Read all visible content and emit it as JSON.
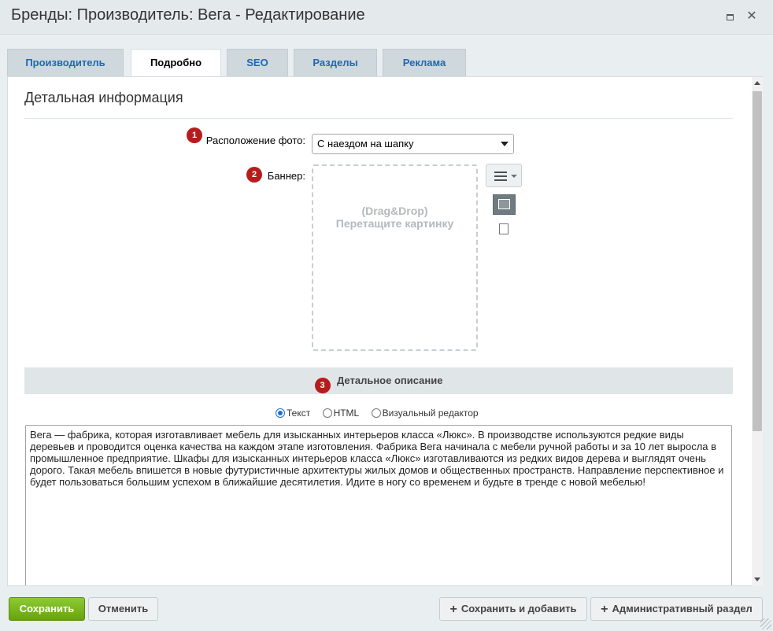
{
  "window": {
    "title": "Бренды: Производитель: Вега - Редактирование",
    "close_glyph": "✕"
  },
  "tabs": [
    {
      "label": "Производитель",
      "active": false
    },
    {
      "label": "Подробно",
      "active": true
    },
    {
      "label": "SEO",
      "active": false
    },
    {
      "label": "Разделы",
      "active": false
    },
    {
      "label": "Реклама",
      "active": false
    }
  ],
  "section": {
    "title": "Детальная информация"
  },
  "fields": {
    "photo_position": {
      "badge": "1",
      "label": "Расположение фото:",
      "value": "С наездом на шапку"
    },
    "banner": {
      "badge": "2",
      "label": "Баннер:",
      "drop_line1": "(Drag&Drop)",
      "drop_line2": "Перетащите картинку"
    }
  },
  "description": {
    "badge": "3",
    "title": "Детальное описание",
    "modes": [
      {
        "label": "Текст",
        "selected": true
      },
      {
        "label": "HTML",
        "selected": false
      },
      {
        "label": "Визуальный редактор",
        "selected": false
      }
    ],
    "text": "Вега — фабрика, которая изготавливает мебель для изысканных интерьеров класса «Люкс». В производстве используются редкие виды деревьев и проводится оценка качества на каждом этапе изготовления. Фабрика Вега начинала с мебели ручной работы и за 10 лет выросла в промышленное предприятие. Шкафы для изысканных интерьеров класса «Люкс» изготавливаются из редких видов дерева и выглядят очень дорого. Такая мебель впишется в новые футуристичные архитектуры жилых домов и общественных пространств. Направление перспективное и будет пользоваться большим успехом в ближайшие десятилетия. Идите в ногу со временем и будьте в тренде с новой мебелью!"
  },
  "footer": {
    "save": "Сохранить",
    "cancel": "Отменить",
    "save_add": "Сохранить и добавить",
    "admin": "Административный раздел"
  },
  "colors": {
    "accent_green": "#7ab51d",
    "badge_red": "#b71c1c",
    "tab_link": "#2067b0"
  }
}
